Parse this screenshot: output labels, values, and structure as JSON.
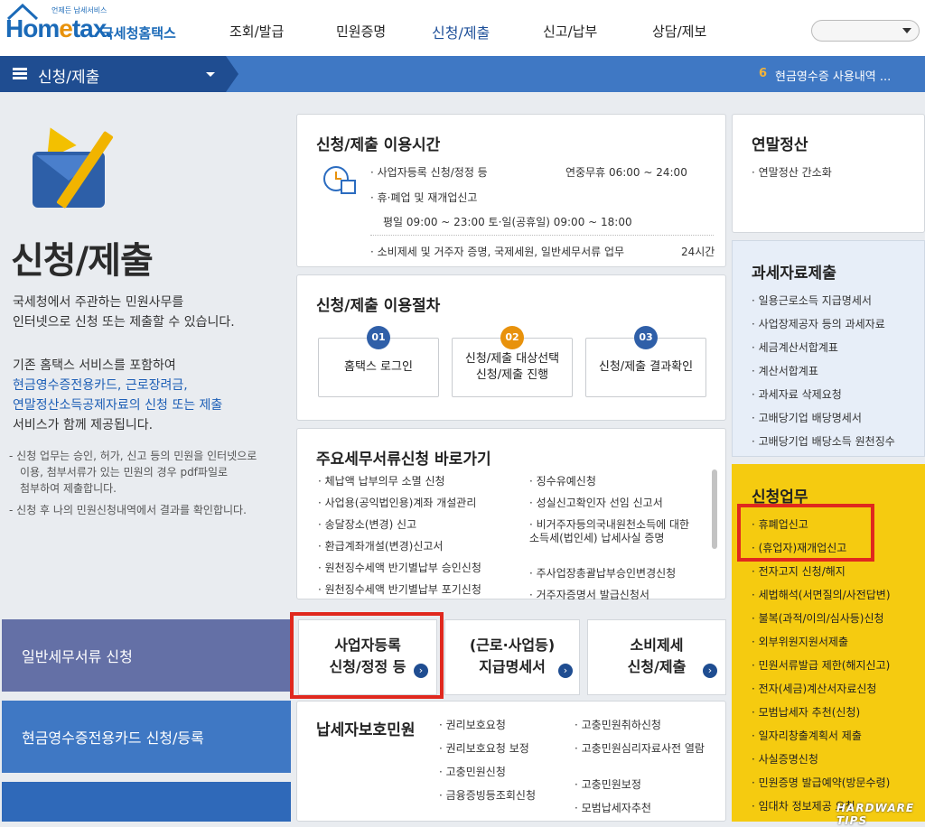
{
  "header": {
    "logo_text": "Hometax.",
    "logo_brand": "국세청홈택스",
    "logo_small": "언제든 납세서비스",
    "nav": [
      "조회/발급",
      "민원증명",
      "신청/제출",
      "신고/납부",
      "상담/제보"
    ]
  },
  "bluebar": {
    "title": "신청/제출",
    "ticker_num": "6",
    "ticker_text": "현금영수증 사용내역 ..."
  },
  "left": {
    "big_title": "신청/제출",
    "desc1": "국세청에서 주관하는 민원사무를",
    "desc2": "인터넷으로 신청 또는 제출할 수 있습니다.",
    "desc3": "기존 홈택스 서비스를 포함하여",
    "desc4": "현금영수증전용카드, 근로장려금,",
    "desc5": "연말정산소득공제자료의 신청 또는 제출",
    "desc6": "서비스가 함께 제공됩니다.",
    "note1a": "신청 업무는 승인, 허가, 신고 등의 민원을 인터넷으로",
    "note1b": "이용, 첨부서류가 있는 민원의 경우 pdf파일로",
    "note1c": "첨부하여 제출합니다.",
    "note2": "신청 후 나의 민원신청내역에서 결과를 확인합니다.",
    "btn1": "일반세무서류 신청",
    "btn2": "현금영수증전용카드 신청/등록"
  },
  "hours": {
    "title": "신청/제출 이용시간",
    "r1_label": "사업자등록 신청/정정 등",
    "r1_value": "연중무휴 06:00 ~ 24:00",
    "r2_label": "휴·폐업 및 재개업신고",
    "r2_value": "평일 09:00 ~ 23:00 토·일(공휴일) 09:00 ~ 18:00",
    "r3_label": "소비제세 및 거주자 증명, 국제세원, 일반세무서류 업무",
    "r3_value": "24시간"
  },
  "procedure": {
    "title": "신청/제출 이용절차",
    "steps": [
      {
        "num": "01",
        "label": "홈택스 로그인"
      },
      {
        "num": "02",
        "label": "신청/제출 대상선택\n신청/제출 진행"
      },
      {
        "num": "03",
        "label": "신청/제출 결과확인"
      }
    ]
  },
  "shortcuts": {
    "title": "주요세무서류신청 바로가기",
    "col1": [
      "체납액 납부의무 소멸 신청",
      "사업용(공익법인용)계좌 개설관리",
      "송달장소(변경) 신고",
      "환급계좌개설(변경)신고서",
      "원천징수세액 반기별납부 승인신청",
      "원천징수세액 반기별납부 포기신청"
    ],
    "col2": [
      "징수유예신청",
      "성실신고확인자 선임 신고서",
      "비거주자등의국내원천소득에 대한 소득세(법인세) 납세사실 증명",
      "주사업장총괄납부승인변경신청",
      "거주자증명서 발급신청서"
    ]
  },
  "bigbuttons": [
    {
      "l1": "사업자등록",
      "l2": "신청/정정 등"
    },
    {
      "l1": "(근로·사업등)",
      "l2": "지급명세서"
    },
    {
      "l1": "소비제세",
      "l2": "신청/제출"
    }
  ],
  "protection": {
    "title": "납세자보호민원",
    "col1": [
      "권리보호요청",
      "권리보호요청 보정",
      "고충민원신청",
      "금융증빙등조회신청"
    ],
    "col2": [
      "고충민원취하신청",
      "고충민원심리자료사전 열람",
      "고충민원보정",
      "모범납세자추천"
    ]
  },
  "yearend": {
    "title": "연말정산",
    "items": [
      "연말정산 간소화"
    ]
  },
  "taxdata": {
    "title": "과세자료제출",
    "items": [
      "일용근로소득 지급명세서",
      "사업장제공자 등의 과세자료",
      "세금계산서합계표",
      "계산서합계표",
      "과세자료 삭제요청",
      "고배당기업 배당명세서",
      "고배당기업 배당소득 원천징수"
    ]
  },
  "apply": {
    "title": "신청업무",
    "items": [
      "휴폐업신고",
      "(휴업자)재개업신고",
      "전자고지 신청/해지",
      "세법해석(서면질의/사전답변)",
      "불복(과적/이의/심사등)신청",
      "외부위원지원서제출",
      "민원서류발급 제한(해지신고)",
      "전자(세금)계산서자료신청",
      "모범납세자 추천(신청)",
      "일자리창출계획서 제출",
      "사실증명신청",
      "민원증명 발급예약(방문수령)",
      "임대차 정보제공 요청"
    ]
  },
  "watermark": "HARDWARE TIPS",
  "colors": {
    "accent_blue": "#1f4d91",
    "bar_blue": "#3f78c4",
    "yellow_panel": "#f5cb10",
    "highlight_red": "#e0281e",
    "purple_btn": "#6470a6"
  }
}
